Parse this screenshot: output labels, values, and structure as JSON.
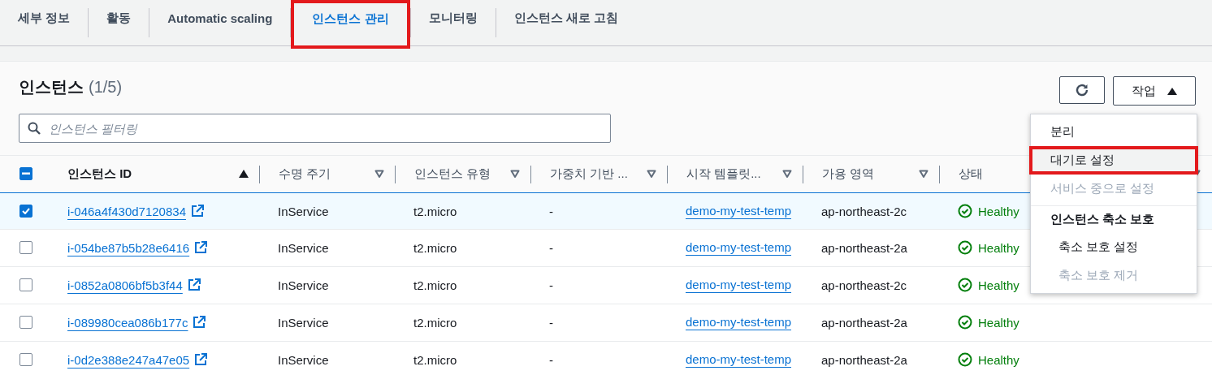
{
  "tabs": [
    {
      "label": "세부 정보",
      "selected": false,
      "highlighted": false
    },
    {
      "label": "활동",
      "selected": false,
      "highlighted": false
    },
    {
      "label": "Automatic scaling",
      "selected": false,
      "highlighted": false
    },
    {
      "label": "인스턴스 관리",
      "selected": true,
      "highlighted": true
    },
    {
      "label": "모니터링",
      "selected": false,
      "highlighted": false
    },
    {
      "label": "인스턴스 새로 고침",
      "selected": false,
      "highlighted": false
    }
  ],
  "panel": {
    "title": "인스턴스",
    "count": "(1/5)",
    "filter": {
      "placeholder": "인스턴스 필터링"
    },
    "actions_button": {
      "label": "작업",
      "expanded": true
    },
    "menu": [
      {
        "kind": "item",
        "label": "분리",
        "disabled": false,
        "highlighted": false
      },
      {
        "kind": "item",
        "label": "대기로 설정",
        "disabled": false,
        "highlighted": true
      },
      {
        "kind": "item",
        "label": "서비스 중으로 설정",
        "disabled": true,
        "highlighted": false
      },
      {
        "kind": "group",
        "label": "인스턴스 축소 보호",
        "children": [
          {
            "kind": "item",
            "label": "축소 보호 설정",
            "disabled": false,
            "highlighted": false
          },
          {
            "kind": "item",
            "label": "축소 보호 제거",
            "disabled": true,
            "highlighted": false
          }
        ]
      }
    ]
  },
  "table": {
    "header_checkbox": {
      "indeterminate": true
    },
    "columns": [
      {
        "label": "인스턴스 ID",
        "sorted": true
      },
      {
        "label": "수명 주기",
        "sorted": false
      },
      {
        "label": "인스턴스 유형",
        "sorted": false
      },
      {
        "label": "가중치 기반 ...",
        "sorted": false
      },
      {
        "label": "시작 템플릿...",
        "sorted": false
      },
      {
        "label": "가용 영역",
        "sorted": false
      },
      {
        "label": "상태",
        "sorted": false
      }
    ],
    "rows": [
      {
        "selected": true,
        "id": "i-046a4f430d7120834",
        "lifecycle": "InService",
        "type": "t2.micro",
        "weight": "-",
        "template": "demo-my-test-temp",
        "zone": "ap-northeast-2c",
        "status": "Healthy"
      },
      {
        "selected": false,
        "id": "i-054be87b5b28e6416",
        "lifecycle": "InService",
        "type": "t2.micro",
        "weight": "-",
        "template": "demo-my-test-temp",
        "zone": "ap-northeast-2a",
        "status": "Healthy"
      },
      {
        "selected": false,
        "id": "i-0852a0806bf5b3f44",
        "lifecycle": "InService",
        "type": "t2.micro",
        "weight": "-",
        "template": "demo-my-test-temp",
        "zone": "ap-northeast-2c",
        "status": "Healthy"
      },
      {
        "selected": false,
        "id": "i-089980cea086b177c",
        "lifecycle": "InService",
        "type": "t2.micro",
        "weight": "-",
        "template": "demo-my-test-temp",
        "zone": "ap-northeast-2a",
        "status": "Healthy"
      },
      {
        "selected": false,
        "id": "i-0d2e388e247a47e05",
        "lifecycle": "InService",
        "type": "t2.micro",
        "weight": "-",
        "template": "demo-my-test-temp",
        "zone": "ap-northeast-2a",
        "status": "Healthy"
      }
    ]
  }
}
